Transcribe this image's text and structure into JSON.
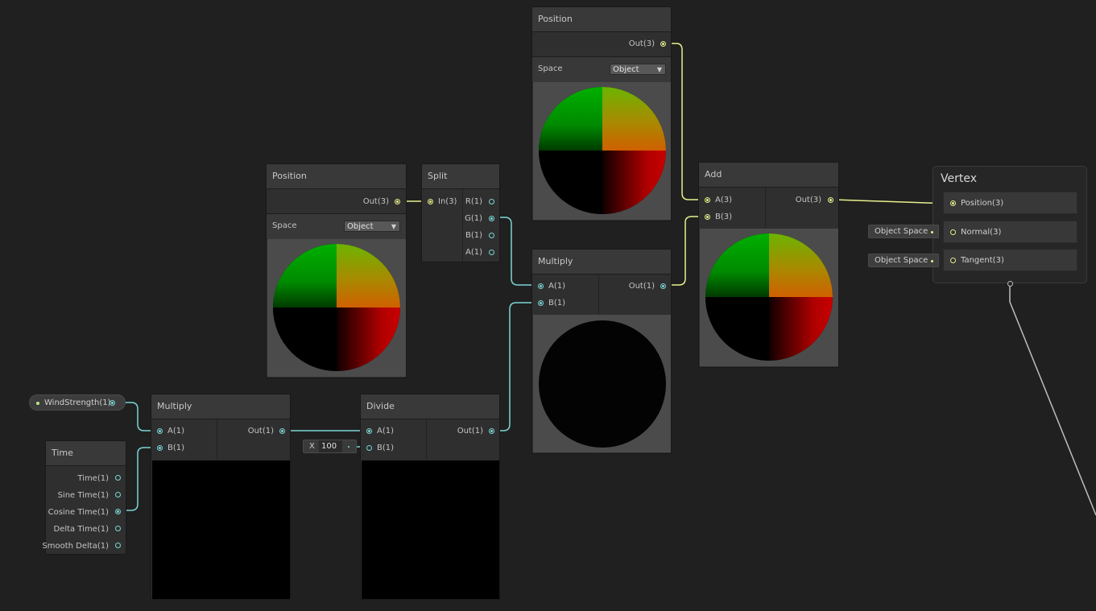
{
  "colors": {
    "background": "#202020",
    "wire_float": "#7ad6d6",
    "wire_vector3": "#e8f08c",
    "wire_vertex": "#bdbdbd"
  },
  "position_top": {
    "title": "Position",
    "output": "Out(3)",
    "space_label": "Space",
    "space_value": "Object"
  },
  "position_left": {
    "title": "Position",
    "output": "Out(3)",
    "space_label": "Space",
    "space_value": "Object"
  },
  "split": {
    "title": "Split",
    "input": "In(3)",
    "outputs": [
      "R(1)",
      "G(1)",
      "B(1)",
      "A(1)"
    ]
  },
  "multiply_center": {
    "title": "Multiply",
    "input_a": "A(1)",
    "input_b": "B(1)",
    "output": "Out(1)"
  },
  "add": {
    "title": "Add",
    "input_a": "A(3)",
    "input_b": "B(3)",
    "output": "Out(3)"
  },
  "vertex": {
    "title": "Vertex",
    "slots": [
      "Position(3)",
      "Normal(3)",
      "Tangent(3)"
    ],
    "normal_default": "Object Space",
    "tangent_default": "Object Space"
  },
  "wind_strength": {
    "label": "WindStrength(1)"
  },
  "time": {
    "title": "Time",
    "outputs": [
      "Time(1)",
      "Sine Time(1)",
      "Cosine Time(1)",
      "Delta Time(1)",
      "Smooth Delta(1)"
    ]
  },
  "multiply_bottom": {
    "title": "Multiply",
    "input_a": "A(1)",
    "input_b": "B(1)",
    "output": "Out(1)"
  },
  "divide": {
    "title": "Divide",
    "input_a": "A(1)",
    "input_b": "B(1)",
    "output": "Out(1)",
    "b_field_axis": "X",
    "b_field_value": "100"
  }
}
